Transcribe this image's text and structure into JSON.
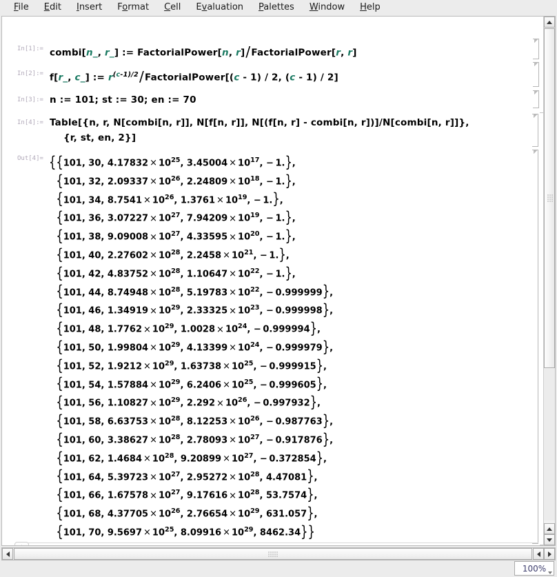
{
  "menu": {
    "items": [
      {
        "label": "File",
        "accel": "F"
      },
      {
        "label": "Edit",
        "accel": "E"
      },
      {
        "label": "Insert",
        "accel": "I"
      },
      {
        "label": "Format",
        "accel": "o"
      },
      {
        "label": "Cell",
        "accel": "C"
      },
      {
        "label": "Evaluation",
        "accel": "v"
      },
      {
        "label": "Palettes",
        "accel": "P"
      },
      {
        "label": "Window",
        "accel": "W"
      },
      {
        "label": "Help",
        "accel": "H"
      }
    ]
  },
  "notebook": {
    "cells": [
      {
        "label": "In[1]:=",
        "kind": "input",
        "text": "combi[n_, r_] := FactorialPower[n, r] / FactorialPower[r, r]"
      },
      {
        "label": "In[2]:=",
        "kind": "input",
        "text": "f[r_, c_] := r^((c-1)/2) / FactorialPower[(c - 1) / 2, (c - 1) / 2]"
      },
      {
        "label": "In[3]:=",
        "kind": "input",
        "text": "n := 101; st := 30; en := 70"
      },
      {
        "label": "In[4]:=",
        "kind": "input",
        "line1": "Table[{n, r, N[combi[n, r]], N[f[n, r]], N[(f[n, r] - combi[n, r])]/N[combi[n, r]]},",
        "line2": "{r, st, en, 2}]"
      },
      {
        "label": "Out[4]=",
        "kind": "output"
      }
    ]
  },
  "output_rows": [
    {
      "n": "101",
      "r": "30",
      "combi_m": "4.17832",
      "combi_e": "25",
      "f_m": "3.45004",
      "f_e": "17",
      "ratio": "-1."
    },
    {
      "n": "101",
      "r": "32",
      "combi_m": "2.09337",
      "combi_e": "26",
      "f_m": "2.24809",
      "f_e": "18",
      "ratio": "-1."
    },
    {
      "n": "101",
      "r": "34",
      "combi_m": "8.7541",
      "combi_e": "26",
      "f_m": "1.3761",
      "f_e": "19",
      "ratio": "-1."
    },
    {
      "n": "101",
      "r": "36",
      "combi_m": "3.07227",
      "combi_e": "27",
      "f_m": "7.94209",
      "f_e": "19",
      "ratio": "-1."
    },
    {
      "n": "101",
      "r": "38",
      "combi_m": "9.09008",
      "combi_e": "27",
      "f_m": "4.33595",
      "f_e": "20",
      "ratio": "-1."
    },
    {
      "n": "101",
      "r": "40",
      "combi_m": "2.27602",
      "combi_e": "28",
      "f_m": "2.2458",
      "f_e": "21",
      "ratio": "-1."
    },
    {
      "n": "101",
      "r": "42",
      "combi_m": "4.83752",
      "combi_e": "28",
      "f_m": "1.10647",
      "f_e": "22",
      "ratio": "-1."
    },
    {
      "n": "101",
      "r": "44",
      "combi_m": "8.74948",
      "combi_e": "28",
      "f_m": "5.19783",
      "f_e": "22",
      "ratio": "-0.999999"
    },
    {
      "n": "101",
      "r": "46",
      "combi_m": "1.34919",
      "combi_e": "29",
      "f_m": "2.33325",
      "f_e": "23",
      "ratio": "-0.999998"
    },
    {
      "n": "101",
      "r": "48",
      "combi_m": "1.7762",
      "combi_e": "29",
      "f_m": "1.0028",
      "f_e": "24",
      "ratio": "-0.999994"
    },
    {
      "n": "101",
      "r": "50",
      "combi_m": "1.99804",
      "combi_e": "29",
      "f_m": "4.13399",
      "f_e": "24",
      "ratio": "-0.999979"
    },
    {
      "n": "101",
      "r": "52",
      "combi_m": "1.9212",
      "combi_e": "29",
      "f_m": "1.63738",
      "f_e": "25",
      "ratio": "-0.999915"
    },
    {
      "n": "101",
      "r": "54",
      "combi_m": "1.57884",
      "combi_e": "29",
      "f_m": "6.2406",
      "f_e": "25",
      "ratio": "-0.999605"
    },
    {
      "n": "101",
      "r": "56",
      "combi_m": "1.10827",
      "combi_e": "29",
      "f_m": "2.292",
      "f_e": "26",
      "ratio": "-0.997932"
    },
    {
      "n": "101",
      "r": "58",
      "combi_m": "6.63753",
      "combi_e": "28",
      "f_m": "8.12253",
      "f_e": "26",
      "ratio": "-0.987763"
    },
    {
      "n": "101",
      "r": "60",
      "combi_m": "3.38627",
      "combi_e": "28",
      "f_m": "2.78093",
      "f_e": "27",
      "ratio": "-0.917876"
    },
    {
      "n": "101",
      "r": "62",
      "combi_m": "1.4684",
      "combi_e": "28",
      "f_m": "9.20899",
      "f_e": "27",
      "ratio": "-0.372854"
    },
    {
      "n": "101",
      "r": "64",
      "combi_m": "5.39723",
      "combi_e": "27",
      "f_m": "2.95272",
      "f_e": "28",
      "ratio": "4.47081"
    },
    {
      "n": "101",
      "r": "66",
      "combi_m": "1.67578",
      "combi_e": "27",
      "f_m": "9.17616",
      "f_e": "28",
      "ratio": "53.7574"
    },
    {
      "n": "101",
      "r": "68",
      "combi_m": "4.37705",
      "combi_e": "26",
      "f_m": "2.76654",
      "f_e": "29",
      "ratio": "631.057"
    },
    {
      "n": "101",
      "r": "70",
      "combi_m": "9.5697",
      "combi_e": "25",
      "f_m": "8.09916",
      "f_e": "29",
      "ratio": "8462.34"
    }
  ],
  "statusbar": {
    "zoom_level": "100%"
  },
  "colors": {
    "pattern_variable": "#1a7a62",
    "cell_label": "#b0a8b8",
    "chrome": "#ececec",
    "canvas": "#ffffff",
    "bracket": "#b5b5b5"
  },
  "new_cell": {
    "plus_glyph": "+"
  }
}
